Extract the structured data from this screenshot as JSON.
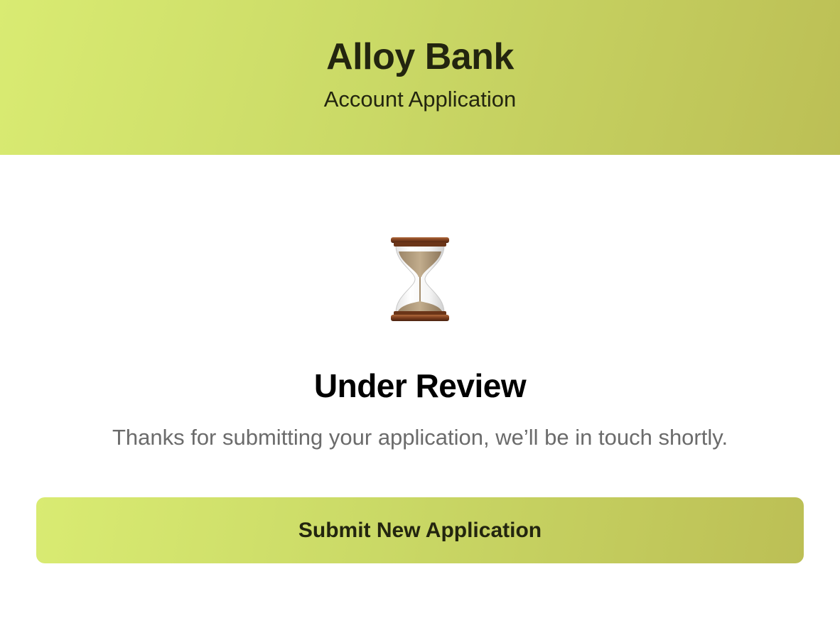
{
  "header": {
    "brand": "Alloy Bank",
    "subtitle": "Account Application"
  },
  "status": {
    "icon": "hourglass-icon",
    "title": "Under Review",
    "message": "Thanks for submitting your application, we’ll be in touch shortly."
  },
  "actions": {
    "submit_label": "Submit New Application"
  },
  "colors": {
    "accent_start": "#d9eb72",
    "accent_end": "#bcbf55",
    "text_dark": "#23250f",
    "text_muted": "#6b6b6b"
  }
}
